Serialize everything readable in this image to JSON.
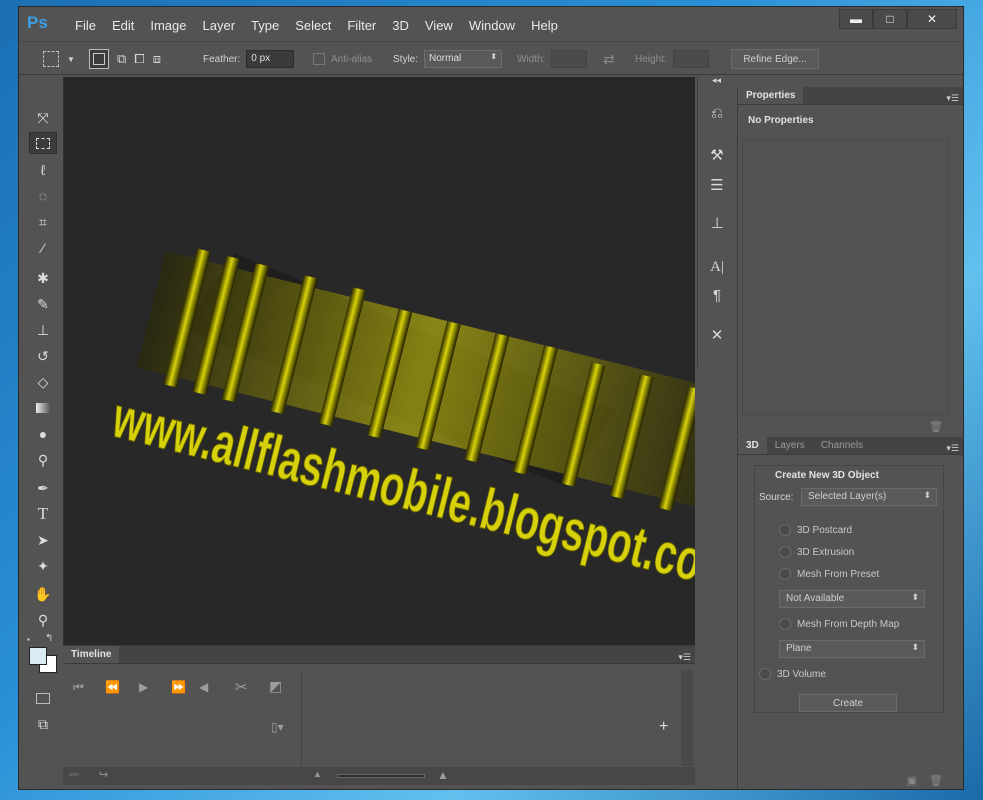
{
  "app": {
    "logo": "Ps"
  },
  "menu": [
    "File",
    "Edit",
    "Image",
    "Layer",
    "Type",
    "Select",
    "Filter",
    "3D",
    "View",
    "Window",
    "Help"
  ],
  "window_controls": {
    "minimize": "▬",
    "maximize": "□",
    "close": "✕"
  },
  "options": {
    "feather_label": "Feather:",
    "feather_value": "0 px",
    "antialias_label": "Anti-alias",
    "style_label": "Style:",
    "style_value": "Normal",
    "width_label": "Width:",
    "height_label": "Height:",
    "refine_edge": "Refine Edge..."
  },
  "canvas": {
    "text": "www.allflashmobile.blogspot.com",
    "text_color": "#d6d10a"
  },
  "properties_panel": {
    "tab": "Properties",
    "content": "No Properties"
  },
  "bottom_panel": {
    "tabs": [
      "3D",
      "Layers",
      "Channels"
    ],
    "heading": "Create New 3D Object",
    "source_label": "Source:",
    "source_value": "Selected Layer(s)",
    "option_postcard": "3D Postcard",
    "option_extrusion": "3D Extrusion",
    "option_preset": "Mesh From Preset",
    "preset_value": "Not Available",
    "option_depth": "Mesh From Depth Map",
    "depth_value": "Plane",
    "option_volume": "3D Volume",
    "create_button": "Create"
  },
  "timeline": {
    "tab": "Timeline"
  }
}
